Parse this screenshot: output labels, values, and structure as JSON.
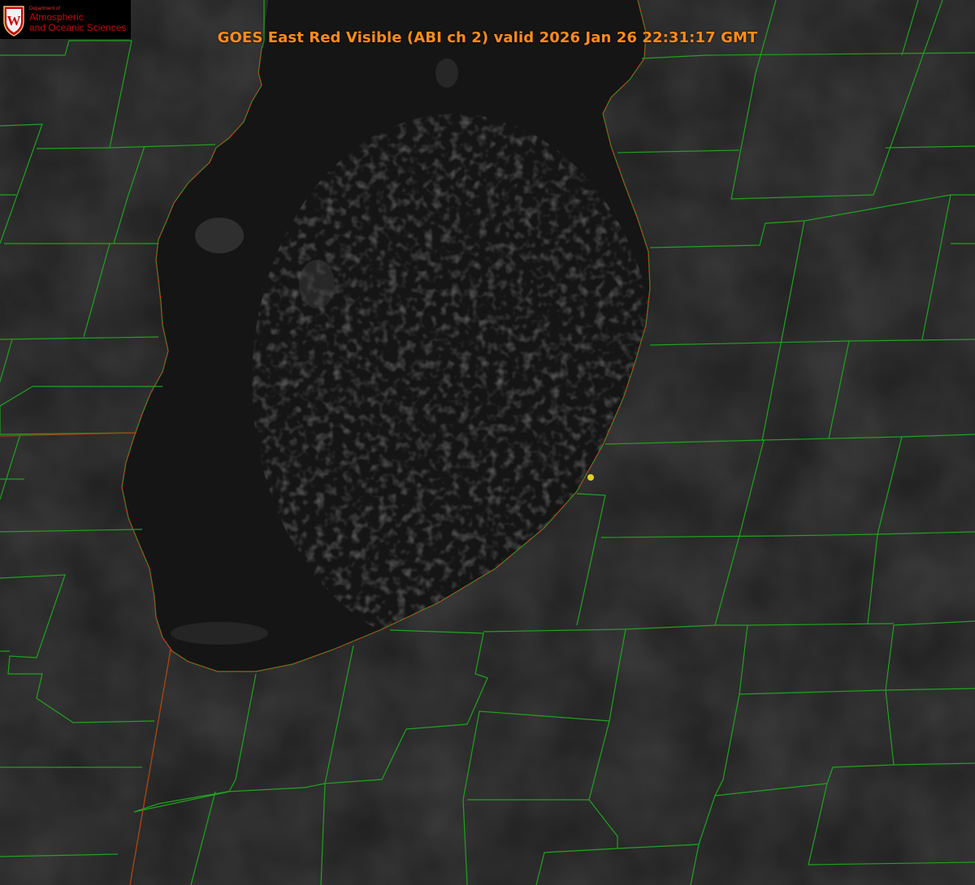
{
  "header": {
    "title": "GOES East Red Visible (ABI ch 2) valid 2026 Jan 26 22:31:17 GMT"
  },
  "logo": {
    "line_small": "Department of",
    "line1": "Atmospheric",
    "line2": "and Oceanic Sciences",
    "crest_letter": "W"
  },
  "colors": {
    "land": "#222222",
    "lake": "#151515",
    "county_lines": "#1fa31f",
    "state_line": "#d02a10",
    "shoreline": "#e02020",
    "marker": "#e0d020",
    "title": "#ff8c1a",
    "logo_red": "#c5050c"
  }
}
